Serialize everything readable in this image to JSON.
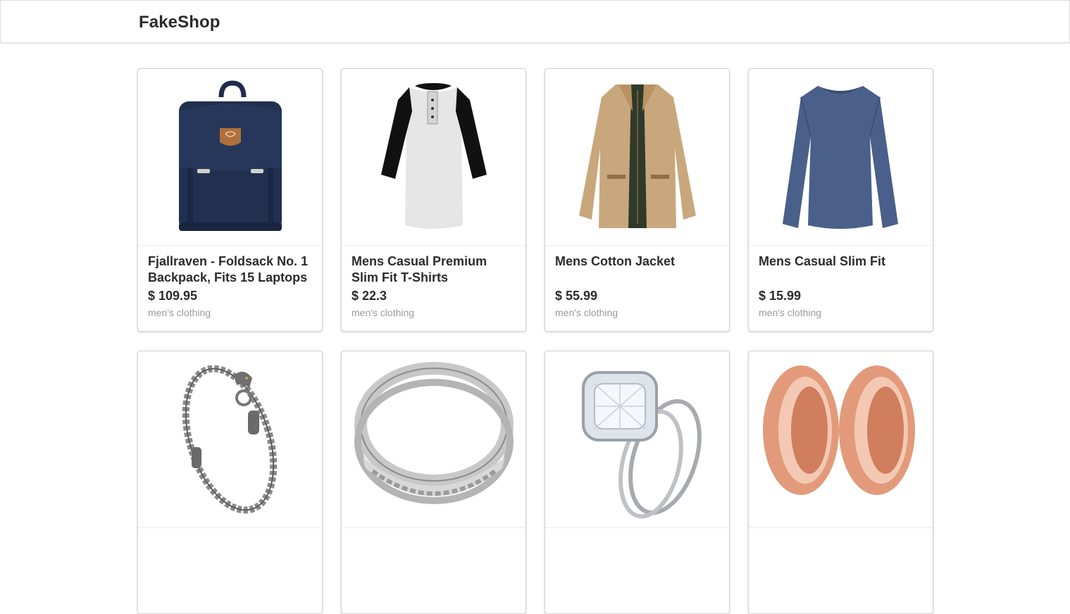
{
  "header": {
    "brand": "FakeShop"
  },
  "products": [
    {
      "title": "Fjallraven - Foldsack No. 1 Backpack, Fits 15 Laptops",
      "price": "$ 109.95",
      "category": "men's clothing",
      "image_icon": "backpack-icon"
    },
    {
      "title": "Mens Casual Premium Slim Fit T-Shirts",
      "price": "$ 22.3",
      "category": "men's clothing",
      "image_icon": "raglan-tshirt-icon"
    },
    {
      "title": "Mens Cotton Jacket",
      "price": "$ 55.99",
      "category": "men's clothing",
      "image_icon": "jacket-icon"
    },
    {
      "title": "Mens Casual Slim Fit",
      "price": "$ 15.99",
      "category": "men's clothing",
      "image_icon": "long-sleeve-shirt-icon"
    },
    {
      "title": "",
      "price": "",
      "category": "",
      "image_icon": "bracelet-icon"
    },
    {
      "title": "",
      "price": "",
      "category": "",
      "image_icon": "silver-ring-icon"
    },
    {
      "title": "",
      "price": "",
      "category": "",
      "image_icon": "diamond-ring-icon"
    },
    {
      "title": "",
      "price": "",
      "category": "",
      "image_icon": "rose-gold-plugs-icon"
    }
  ],
  "colors": {
    "navy_backpack": "#1f2d4a",
    "jacket_khaki": "#c9a77c",
    "shirt_blue": "#4a5f8a",
    "rose_gold": "#e29a7a"
  }
}
